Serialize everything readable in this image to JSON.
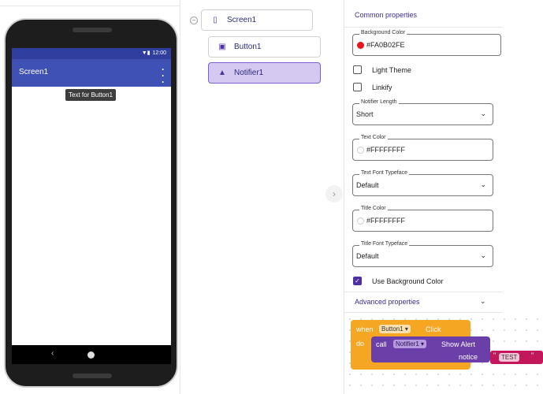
{
  "phone": {
    "status_time": "12:00",
    "app_title": "Screen1",
    "button_tooltip": "Text for Button1",
    "nav_back": "‹"
  },
  "tree": {
    "collapse_glyph": "−",
    "items": [
      {
        "label": "Screen1",
        "icon": "phone-icon"
      },
      {
        "label": "Button1",
        "icon": "button-icon"
      },
      {
        "label": "Notifier1",
        "icon": "bell-icon"
      }
    ],
    "handle_glyph": "›"
  },
  "properties": {
    "common_title": "Common properties",
    "background_color": {
      "label": "Background Color",
      "value": "#FA0B02FE",
      "swatch": "#e8141e"
    },
    "light_theme": {
      "label": "Light Theme",
      "checked": false
    },
    "linkify": {
      "label": "Linkify",
      "checked": false
    },
    "notifier_length": {
      "label": "Notifier Length",
      "value": "Short"
    },
    "text_color": {
      "label": "Text Color",
      "value": "#FFFFFFFF"
    },
    "text_font": {
      "label": "Text Font Typeface",
      "value": "Default"
    },
    "title_color": {
      "label": "Title Color",
      "value": "#FFFFFFFF"
    },
    "title_font": {
      "label": "Title Font Typeface",
      "value": "Default"
    },
    "use_bg_color": {
      "label": "Use Background Color",
      "checked": true,
      "check_glyph": "✓"
    },
    "advanced_title": "Advanced properties",
    "advanced_chevron": "⌄"
  },
  "blocks": {
    "when": "when",
    "component": "Button1",
    "event": "Click",
    "do": "do",
    "call": "call",
    "notifier": "Notifier1",
    "method": "Show Alert",
    "arg": "notice",
    "quote_open": "\"",
    "text_value": "TEST",
    "quote_close": "\"",
    "dropdown_glyph": "▾"
  },
  "colors": {
    "appbar": "#3f51b5",
    "statusbar": "#303f9f",
    "accent": "#4b2fa3",
    "event_block": "#f5a623",
    "call_block": "#6b3fa8",
    "text_block": "#c2185b"
  }
}
